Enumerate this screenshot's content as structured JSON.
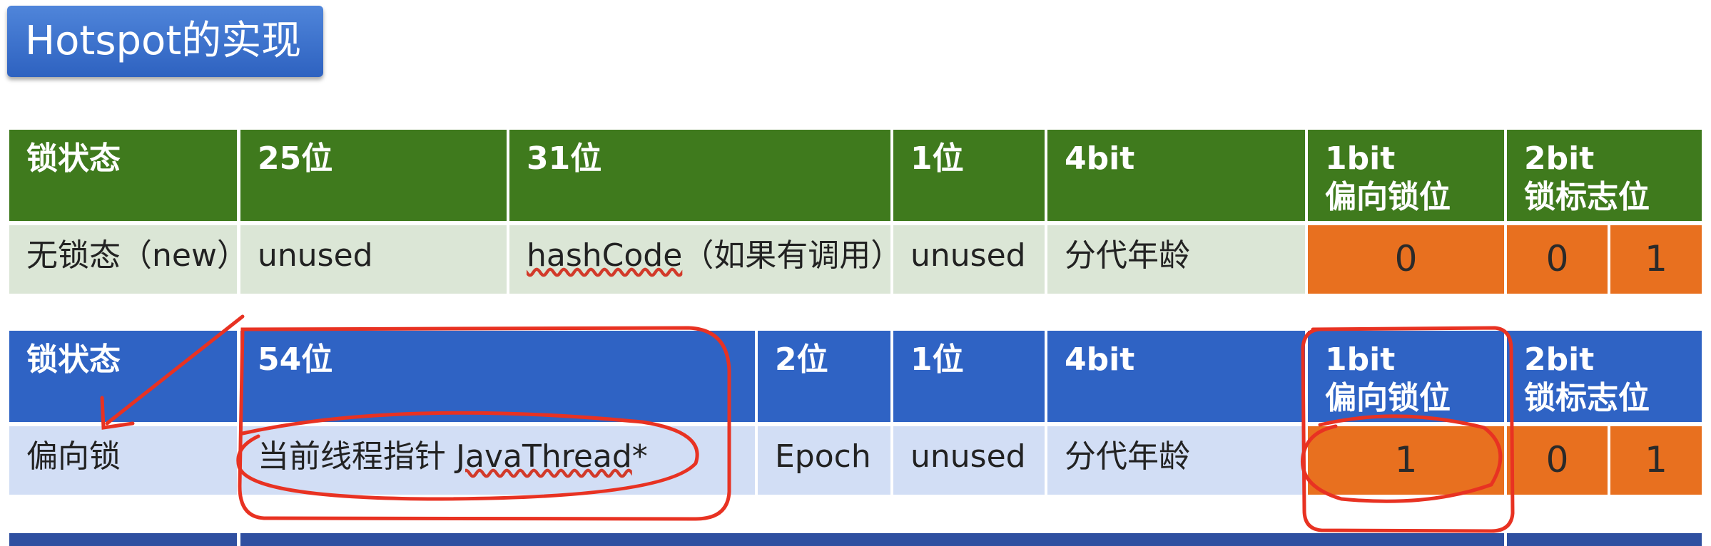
{
  "title": "Hotspot的实现",
  "colors": {
    "green_header": "#3f7a1d",
    "green_row": "#dbe6d6",
    "blue_header": "#2f63c4",
    "blue_row": "#d2def5",
    "orange": "#e8701f",
    "annotation_red": "#e83222"
  },
  "table_unlocked": {
    "headers": {
      "state": "锁状态",
      "bits25": "25位",
      "bits31": "31位",
      "bit1": "1位",
      "age": "4bit",
      "biased_line1": "1bit",
      "biased_line2": "偏向锁位",
      "flag_line1": "2bit",
      "flag_line2": "锁标志位"
    },
    "row": {
      "state": "无锁态（new）",
      "unused1": "unused",
      "hash_word": "hashCode",
      "hash_rest": "（如果有调用）",
      "unused2": "unused",
      "age": "分代年龄",
      "biased": "0",
      "flag_a": "0",
      "flag_b": "1"
    }
  },
  "table_biased": {
    "headers": {
      "state": "锁状态",
      "bits54": "54位",
      "bits2": "2位",
      "bit1": "1位",
      "age": "4bit",
      "biased_line1": "1bit",
      "biased_line2": "偏向锁位",
      "flag_line1": "2bit",
      "flag_line2": "锁标志位"
    },
    "row": {
      "state": "偏向锁",
      "thread_prefix": "当前线程指针 ",
      "thread_word": "JavaThread",
      "thread_suffix": "*",
      "epoch": "Epoch",
      "unused": "unused",
      "age": "分代年龄",
      "biased": "1",
      "flag_a": "0",
      "flag_b": "1"
    }
  }
}
